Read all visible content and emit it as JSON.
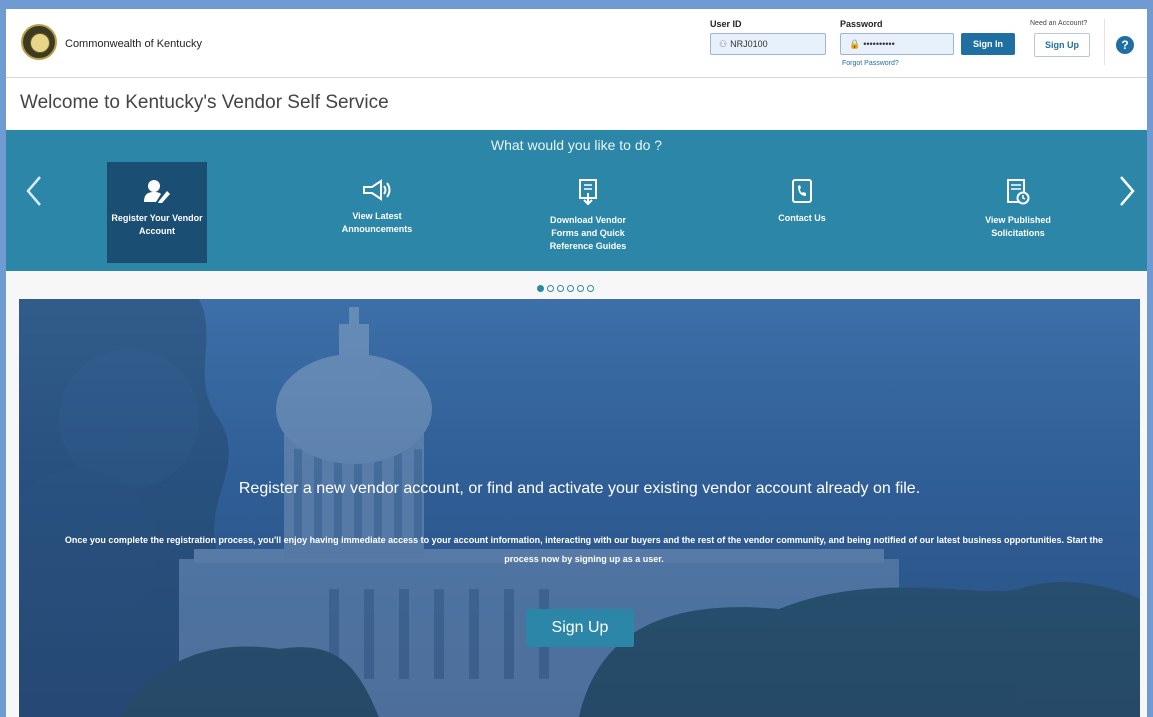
{
  "header": {
    "brand": "Commonwealth of Kentucky",
    "user_id_label": "User ID",
    "user_id_value": "NRJ0100",
    "password_label": "Password",
    "password_value": "••••••••••",
    "sign_in": "Sign In",
    "forgot_password": "Forgot Password?",
    "need_account": "Need an Account?",
    "sign_up": "Sign Up",
    "help": "?"
  },
  "welcome": "Welcome to Kentucky's Vendor Self Service",
  "carousel": {
    "title": "What would you like to do ?",
    "prev": "‹",
    "next": "›",
    "actions": [
      {
        "label": "Register Your Vendor Account",
        "icon": "user-edit-icon",
        "active": true
      },
      {
        "label": "View Latest Announcements",
        "icon": "megaphone-icon",
        "active": false
      },
      {
        "label": "Download Vendor Forms and Quick Reference Guides",
        "icon": "document-download-icon",
        "active": false
      },
      {
        "label": "Contact Us",
        "icon": "phone-book-icon",
        "active": false
      },
      {
        "label": "View Published Solicitations",
        "icon": "solicitation-document-icon",
        "active": false
      }
    ],
    "page_count": 6,
    "current_page": 1
  },
  "hero": {
    "title": "Register a new vendor account, or find and activate your existing vendor account already on file.",
    "body": "Once you complete the registration process, you'll enjoy having immediate access to your account information, interacting with our buyers and the rest of the vendor community, and being notified of our latest business opportunities. Start the process now by signing up as a user.",
    "button": "Sign Up"
  },
  "colors": {
    "page_background": "#6f9bd2",
    "carousel": "#2b86a7",
    "active_tile": "#1a4e72",
    "primary_button": "#1f6fa3"
  }
}
